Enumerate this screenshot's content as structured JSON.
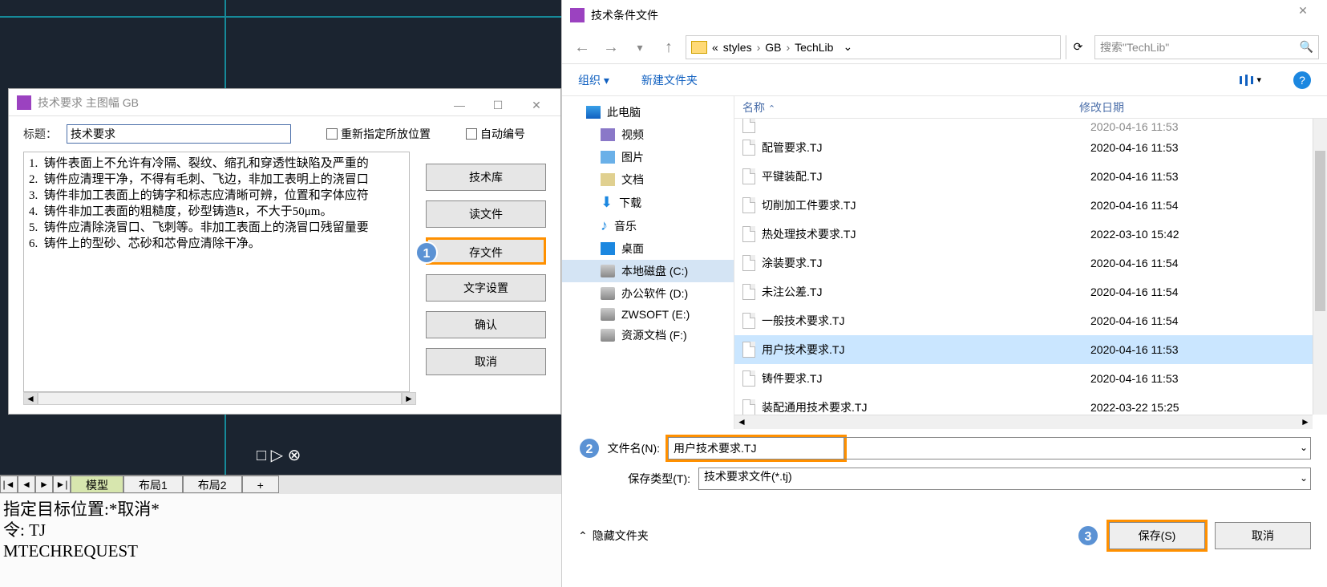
{
  "cad": {
    "anchor_glyphs": "□   ▷   ⊗"
  },
  "dlg1": {
    "title": "技术要求 主图幅 GB",
    "label_title": "标题：",
    "title_value": "技术要求",
    "chk1": "重新指定所放位置",
    "chk2": "自动编号",
    "text": "1.  铸件表面上不允许有冷隔、裂纹、缩孔和穿透性缺陷及严重的\n2.  铸件应清理干净，不得有毛刺、飞边，非加工表明上的浇冒口\n3.  铸件非加工表面上的铸字和标志应清晰可辨，位置和字体应符\n4.  铸件非加工表面的粗糙度，砂型铸造R，不大于50μm。\n5.  铸件应清除浇冒口、飞刺等。非加工表面上的浇冒口残留量要\n6.  铸件上的型砂、芯砂和芯骨应清除干净。",
    "btns": [
      "技术库",
      "读文件",
      "存文件",
      "文字设置",
      "确认",
      "取消"
    ]
  },
  "tabs": {
    "model": "模型",
    "layout1": "布局1",
    "layout2": "布局2",
    "plus": "+"
  },
  "cmd": "指定目标位置:*取消*\n令: TJ\nMTECHREQUEST",
  "save": {
    "title": "技术条件文件",
    "crumb1_pre": "«",
    "crumb1": "styles",
    "crumb2": "GB",
    "crumb3": "TechLib",
    "search_ph": "搜索\"TechLib\"",
    "org": "组织",
    "newf": "新建文件夹",
    "tree": {
      "pc": "此电脑",
      "video": "视频",
      "pic": "图片",
      "doc": "文档",
      "dl": "下载",
      "music": "音乐",
      "desk": "桌面",
      "c": "本地磁盘 (C:)",
      "d": "办公软件 (D:)",
      "e": "ZWSOFT (E:)",
      "f": "资源文档 (F:)"
    },
    "col_name": "名称",
    "col_date": "修改日期",
    "files": [
      {
        "n": "配管要求.TJ",
        "d": "2020-04-16 11:53"
      },
      {
        "n": "平键装配.TJ",
        "d": "2020-04-16 11:53"
      },
      {
        "n": "切削加工件要求.TJ",
        "d": "2020-04-16 11:54"
      },
      {
        "n": "热处理技术要求.TJ",
        "d": "2022-03-10 15:42"
      },
      {
        "n": "涂装要求.TJ",
        "d": "2020-04-16 11:54"
      },
      {
        "n": "未注公差.TJ",
        "d": "2020-04-16 11:54"
      },
      {
        "n": "一般技术要求.TJ",
        "d": "2020-04-16 11:54"
      },
      {
        "n": "用户技术要求.TJ",
        "d": "2020-04-16 11:53",
        "sel": true
      },
      {
        "n": "铸件要求.TJ",
        "d": "2020-04-16 11:53"
      },
      {
        "n": "装配通用技术要求.TJ",
        "d": "2022-03-22 15:25"
      }
    ],
    "clipped_date": "2020-04-16 11:53",
    "fn_label": "文件名(N):",
    "fn_value": "用户技术要求.TJ",
    "ft_label": "保存类型(T):",
    "ft_value": "技术要求文件(*.tj)",
    "hide": "隐藏文件夹",
    "save_btn": "保存(S)",
    "cancel_btn": "取消"
  },
  "badges": {
    "b1": "1",
    "b2": "2",
    "b3": "3"
  }
}
